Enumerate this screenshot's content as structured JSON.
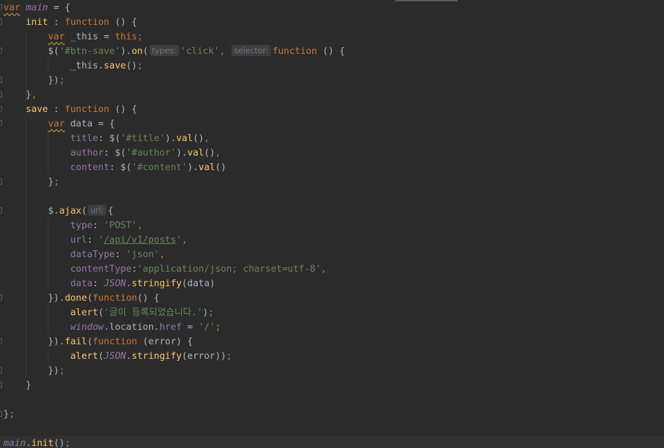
{
  "editor": {
    "lines": [
      {
        "text": "var main = {"
      },
      {
        "text": "    init : function () {"
      },
      {
        "text": "        var _this = this;"
      },
      {
        "text": "        $('#btn-save').on( types: 'click',  selector: function () {"
      },
      {
        "text": "            _this.save();"
      },
      {
        "text": "        });"
      },
      {
        "text": "    },"
      },
      {
        "text": "    save : function () {"
      },
      {
        "text": "        var data = {"
      },
      {
        "text": "            title: $('#title').val(),"
      },
      {
        "text": "            author: $('#author').val(),"
      },
      {
        "text": "            content: $('#content').val()"
      },
      {
        "text": "        };"
      },
      {
        "text": ""
      },
      {
        "text": "        $.ajax( url: {"
      },
      {
        "text": "            type: 'POST',"
      },
      {
        "text": "            url: '/api/v1/posts',"
      },
      {
        "text": "            dataType: 'json',"
      },
      {
        "text": "            contentType:'application/json; charset=utf-8',"
      },
      {
        "text": "            data: JSON.stringify(data)"
      },
      {
        "text": "        }).done(function() {"
      },
      {
        "text": "            alert('글이 등록되었습니다.');"
      },
      {
        "text": "            window.location.href = '/';"
      },
      {
        "text": "        }).fail(function (error) {"
      },
      {
        "text": "            alert(JSON.stringify(error));"
      },
      {
        "text": "        });"
      },
      {
        "text": "    }"
      },
      {
        "text": ""
      },
      {
        "text": "};"
      },
      {
        "text": ""
      },
      {
        "text": "main.init();"
      }
    ]
  },
  "syntax_colors": {
    "background": "#2b2b2b",
    "default": "#a9b7c6",
    "keyword": "#cc7832",
    "function": "#ffc66d",
    "string": "#6a8759",
    "property": "#9876aa",
    "inlay_hint_bg": "#3b3f41",
    "current_line": "#323232"
  }
}
